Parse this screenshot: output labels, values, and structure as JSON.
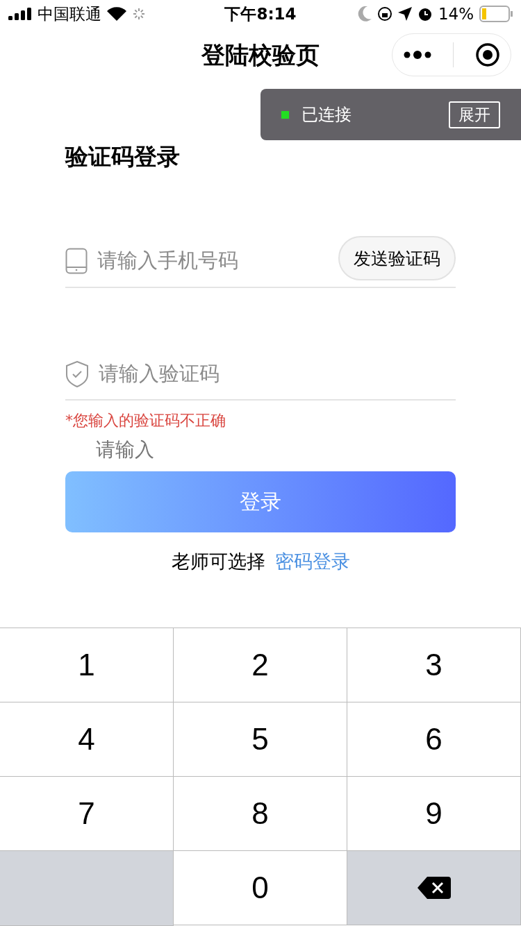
{
  "status_bar": {
    "carrier": "中国联通",
    "time": "下午8:14",
    "battery": "14%"
  },
  "nav_bar": {
    "title": "登陆校验页"
  },
  "connection_banner": {
    "status": "已连接",
    "button": "展开",
    "color": "#22dd22"
  },
  "heading": "验证码登录",
  "phone_field": {
    "placeholder": "请输入手机号码",
    "button": "发送验证码"
  },
  "code_field": {
    "placeholder": "请输入验证码"
  },
  "error": "*您输入的验证码不正确",
  "hint_text": "请输入",
  "login_button": "登录",
  "alt_login": {
    "text": "老师可选择",
    "link": "密码登录"
  },
  "keypad": [
    {
      "kind": "digit",
      "label": "1"
    },
    {
      "kind": "digit",
      "label": "2"
    },
    {
      "kind": "digit",
      "label": "3"
    },
    {
      "kind": "digit",
      "label": "4"
    },
    {
      "kind": "digit",
      "label": "5"
    },
    {
      "kind": "digit",
      "label": "6"
    },
    {
      "kind": "digit",
      "label": "7"
    },
    {
      "kind": "digit",
      "label": "8"
    },
    {
      "kind": "digit",
      "label": "9"
    },
    {
      "kind": "blank"
    },
    {
      "kind": "digit",
      "label": "0"
    },
    {
      "kind": "delete"
    }
  ]
}
